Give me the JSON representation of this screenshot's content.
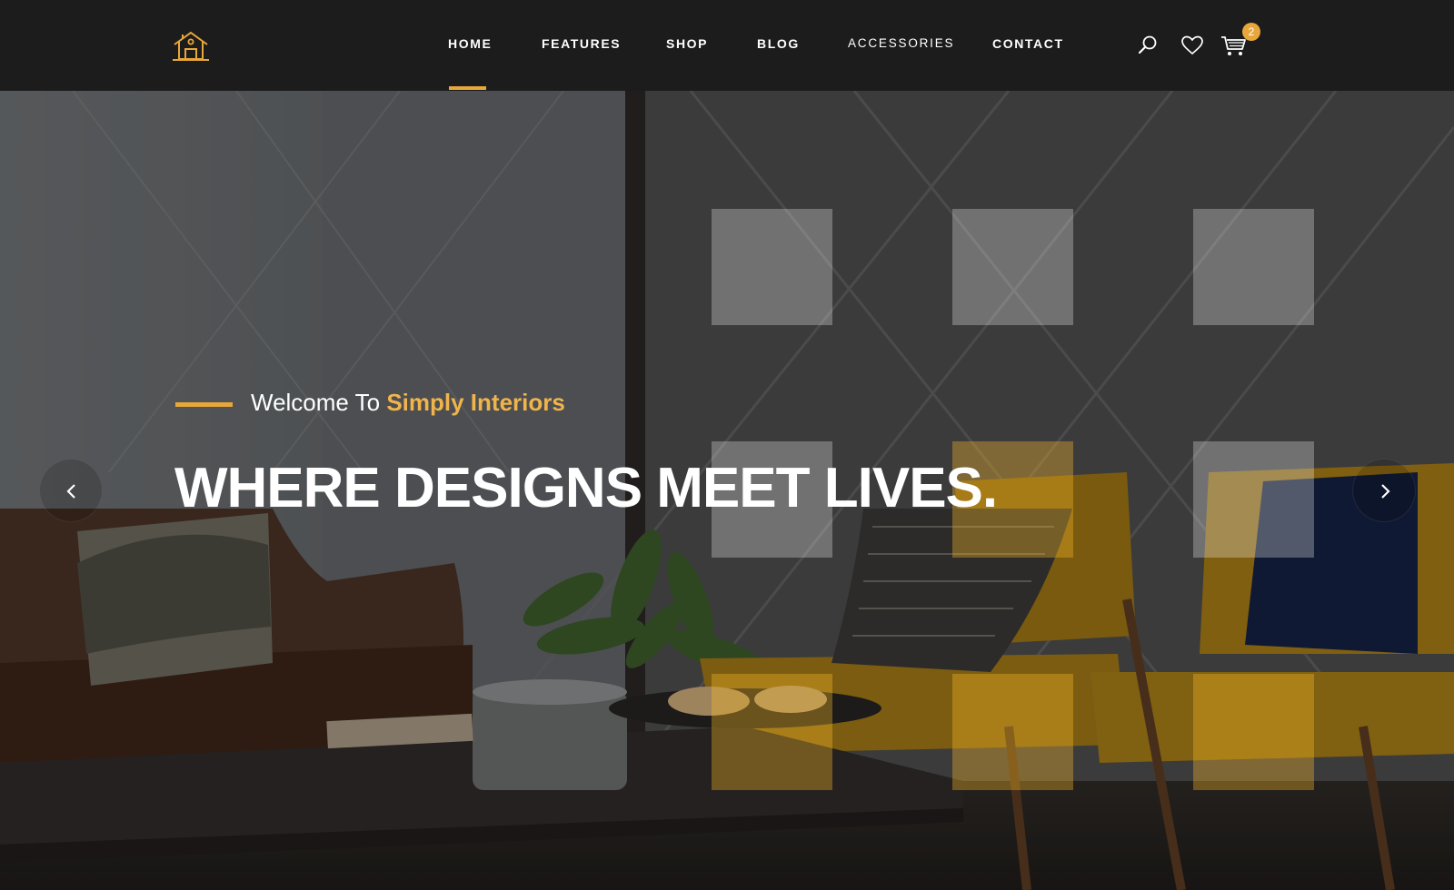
{
  "header": {
    "logo_icon": "house-logo-icon",
    "nav": [
      {
        "label": "HOME",
        "active": true
      },
      {
        "label": "FEATURES"
      },
      {
        "label": "SHOP"
      },
      {
        "label": "BLOG"
      },
      {
        "label": "ACCESSORIES"
      },
      {
        "label": "CONTACT"
      }
    ],
    "icons": [
      "search-icon",
      "heart-icon",
      "cart-icon"
    ],
    "cart_count": "2"
  },
  "hero": {
    "welcome_prefix": "Welcome To ",
    "welcome_brand": "Simply Interiors",
    "headline": "WHERE DESIGNS MEET LIVES.",
    "prev_icon": "chevron-left-icon",
    "next_icon": "chevron-right-icon"
  },
  "colors": {
    "accent": "#e8a73a",
    "header_bg": "#1c1c1c"
  }
}
